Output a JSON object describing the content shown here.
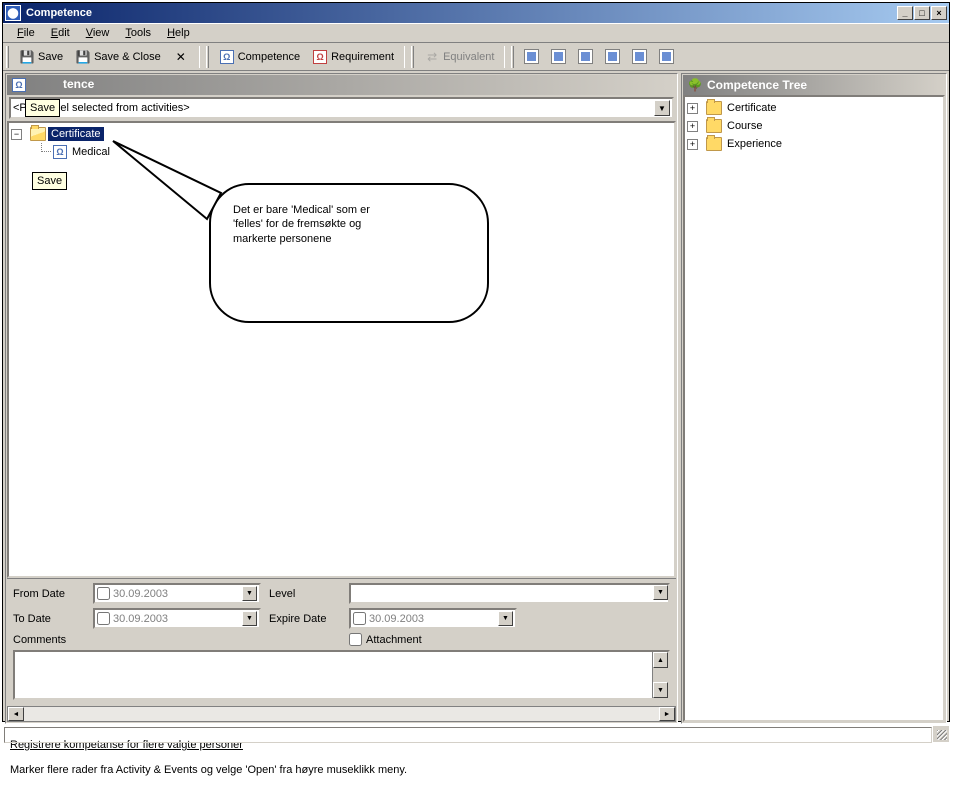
{
  "window": {
    "title": "Competence",
    "min": "_",
    "max": "□",
    "close": "×"
  },
  "menu": {
    "file": "File",
    "edit": "Edit",
    "view": "View",
    "tools": "Tools",
    "help": "Help"
  },
  "toolbar": {
    "save": "Save",
    "save_close": "Save & Close",
    "delete": "",
    "competence": "Competence",
    "requirement": "Requirement",
    "equivalent": "Equivalent"
  },
  "tooltip": {
    "save": "Save"
  },
  "left": {
    "title": "tence",
    "combo": "<Personnel selected from activities>",
    "tree": {
      "root_label": "Certificate",
      "child_label": "Medical"
    },
    "expand_minus": "−",
    "form": {
      "from_date_label": "From Date",
      "to_date_label": "To Date",
      "level_label": "Level",
      "expire_label": "Expire Date",
      "attachment_label": "Attachment",
      "comments_label": "Comments",
      "date_value": "30.09.2003"
    }
  },
  "right": {
    "title": "Competence Tree",
    "items": [
      "Certificate",
      "Course",
      "Experience"
    ],
    "expand_plus": "+"
  },
  "callout": {
    "line1": "Det er bare 'Medical' som er",
    "line2": "'felles' for de fremsøkte og",
    "line3": "markerte personene"
  },
  "caption": {
    "line1": "Registrere kompetanse for flere valgte personer",
    "line2": "Marker flere rader fra Activity & Events og velge 'Open' fra høyre museklikk meny."
  },
  "arrows": {
    "down": "▼",
    "up": "▲",
    "left": "◄",
    "right": "►"
  }
}
